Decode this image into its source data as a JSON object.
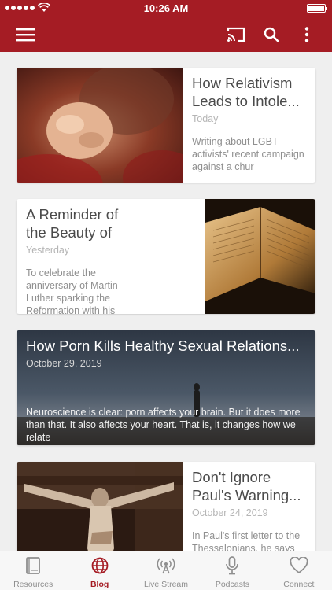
{
  "status_bar": {
    "time": "10:26 AM"
  },
  "colors": {
    "brand": "#a51c24",
    "tab_inactive": "#8e8e8e"
  },
  "app_bar": {
    "icons": [
      "menu-icon",
      "cast-icon",
      "search-icon",
      "more-vertical-icon"
    ]
  },
  "posts": [
    {
      "title": "How Relativism Leads to Intole...",
      "date": "Today",
      "excerpt": "Writing about LGBT activists' recent campaign against a chur",
      "image": "fist-photo"
    },
    {
      "title": "A Reminder of the Beauty of Justification...",
      "date": "Yesterday",
      "excerpt": "To celebrate the anniversary of Martin Luther sparking the Reformation with his",
      "image": "open-bible-photo"
    },
    {
      "title": "How Porn Kills Healthy Sexual Relations...",
      "date": "October 29, 2019",
      "excerpt": "Neuroscience is clear: porn affects your brain. But it does more than that. It also affects your heart. That is, it changes how we relate",
      "image": "silhouette-dusk-photo"
    },
    {
      "title": "Don't Ignore Paul's Warning...",
      "date": "October 24, 2019",
      "excerpt": "In Paul's first letter to the Thessalonians, he says",
      "image": "crucifix-statue-photo"
    }
  ],
  "tabs": [
    {
      "label": "Resources",
      "icon": "book-icon",
      "active": false
    },
    {
      "label": "Blog",
      "icon": "globe-icon",
      "active": true
    },
    {
      "label": "Live Stream",
      "icon": "broadcast-icon",
      "active": false
    },
    {
      "label": "Podcasts",
      "icon": "microphone-icon",
      "active": false
    },
    {
      "label": "Connect",
      "icon": "heart-icon",
      "active": false
    }
  ]
}
